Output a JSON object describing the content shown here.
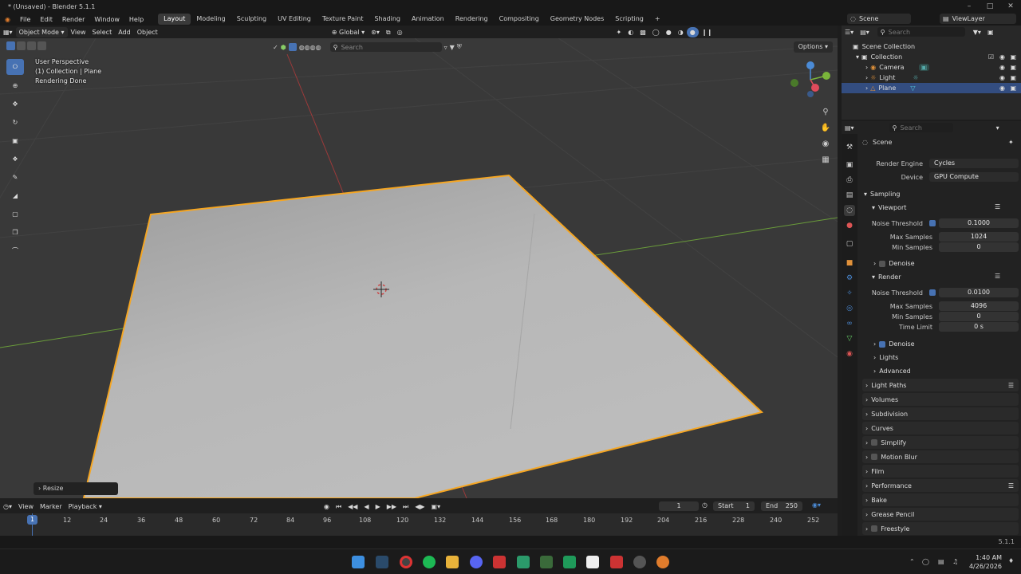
{
  "window": {
    "title": "* (Unsaved) - Blender 5.1.1"
  },
  "menu": [
    "File",
    "Edit",
    "Render",
    "Window",
    "Help"
  ],
  "workspaces": [
    "Layout",
    "Modeling",
    "Sculpting",
    "UV Editing",
    "Texture Paint",
    "Shading",
    "Animation",
    "Rendering",
    "Compositing",
    "Geometry Nodes",
    "Scripting"
  ],
  "topright": {
    "scene": "Scene",
    "view_layer": "ViewLayer"
  },
  "viewport_header": {
    "mode": "Object Mode",
    "menus": [
      "View",
      "Select",
      "Add",
      "Object"
    ],
    "orientation": "Global",
    "search_placeholder": "Search",
    "options": "Options"
  },
  "viewport": {
    "lines": [
      "User Perspective",
      "(1) Collection | Plane",
      "Rendering Done"
    ],
    "resize_label": "Resize"
  },
  "outliner": {
    "search_placeholder": "Search",
    "scene_collection": "Scene Collection",
    "collection": "Collection",
    "items": [
      "Camera",
      "Light",
      "Plane"
    ]
  },
  "properties": {
    "search_placeholder": "Search",
    "context": "Scene",
    "render_engine_label": "Render Engine",
    "render_engine": "Cycles",
    "device_label": "Device",
    "device": "GPU Compute",
    "sampling": "Sampling",
    "viewport": "Viewport",
    "noise_threshold_label": "Noise Threshold",
    "vp_noise_threshold": "0.1000",
    "max_samples_label": "Max Samples",
    "vp_max_samples": "1024",
    "min_samples_label": "Min Samples",
    "vp_min_samples": "0",
    "denoise": "Denoise",
    "render": "Render",
    "r_noise_threshold": "0.0100",
    "r_max_samples": "4096",
    "r_min_samples": "0",
    "time_limit_label": "Time Limit",
    "r_time_limit": "0 s",
    "lights": "Lights",
    "advanced": "Advanced",
    "panels": [
      "Light Paths",
      "Volumes",
      "Subdivision",
      "Curves",
      "Simplify",
      "Motion Blur",
      "Film",
      "Performance",
      "Bake",
      "Grease Pencil",
      "Freestyle"
    ]
  },
  "timeline": {
    "menus": [
      "View",
      "Marker",
      "Playback"
    ],
    "current_frame": "1",
    "start_label": "Start",
    "start": "1",
    "end_label": "End",
    "end": "250",
    "ticks": [
      "1",
      "12",
      "24",
      "36",
      "48",
      "60",
      "72",
      "84",
      "96",
      "108",
      "120",
      "132",
      "144",
      "156",
      "168",
      "180",
      "192",
      "204",
      "216",
      "228",
      "240",
      "252"
    ]
  },
  "status": {
    "version": "5.1.1"
  },
  "taskbar": {
    "time": "1:40 AM",
    "date": "4/26/2026"
  },
  "colors": {
    "accent": "#4772b3",
    "selection": "#f5a623",
    "bg": "#393939"
  }
}
